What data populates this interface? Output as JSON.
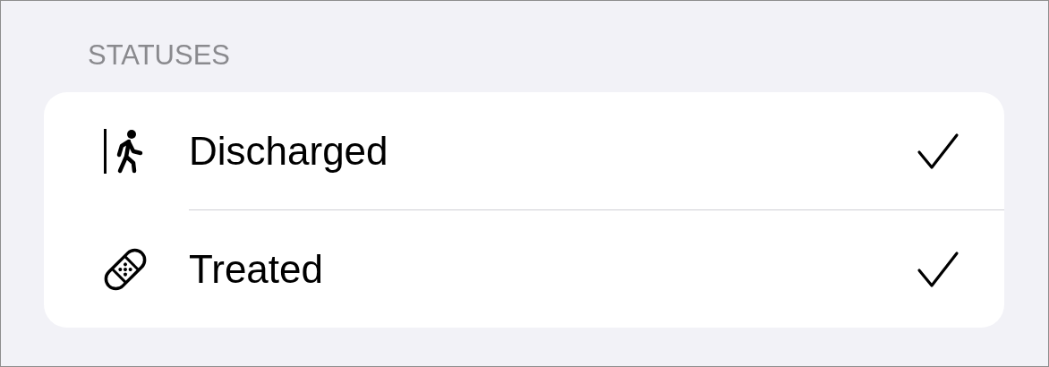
{
  "section": {
    "header": "STATUSES",
    "items": [
      {
        "kind": "walking",
        "label": "Discharged",
        "checked": true
      },
      {
        "kind": "bandage",
        "label": "Treated",
        "checked": true
      }
    ]
  }
}
